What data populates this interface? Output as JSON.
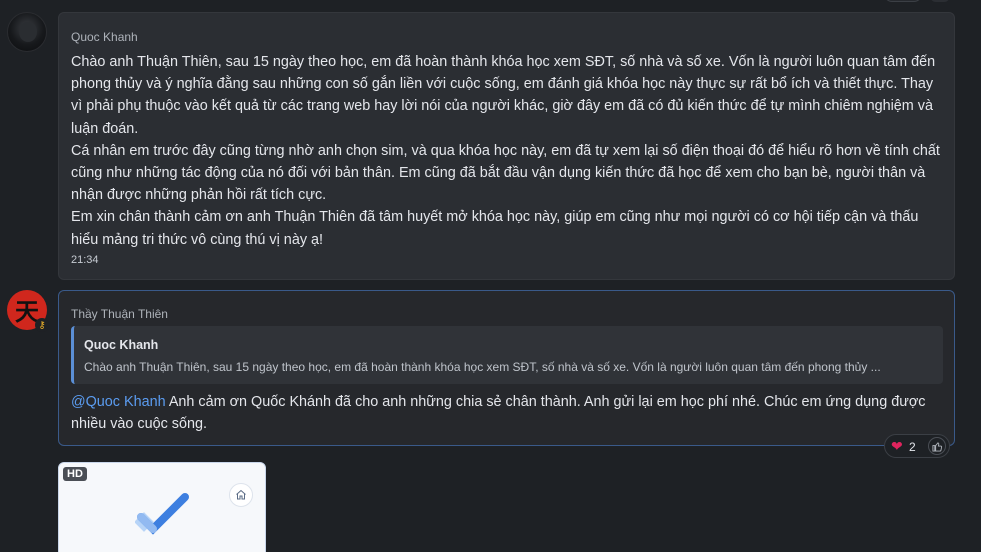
{
  "messages": [
    {
      "author": "Quoc Khanh",
      "paragraphs": [
        "Chào anh Thuận Thiên, sau 15 ngày theo học, em đã hoàn thành khóa học xem SĐT, số nhà và số xe. Vốn là người luôn quan tâm đến phong thủy và ý nghĩa đằng sau những con số gắn liền với cuộc sống, em đánh giá khóa học này thực sự rất bổ ích và thiết thực. Thay vì phải phụ thuộc vào kết quả từ các trang web hay lời nói của người khác, giờ đây em đã có đủ kiến thức để tự mình chiêm nghiệm và luận đoán.",
        "Cá nhân em trước đây cũng từng nhờ anh chọn sim, và qua khóa học này, em đã tự xem lại số điện thoại đó để hiểu rõ hơn về tính chất cũng như những tác động của nó đối với bản thân. Em cũng đã bắt đầu vận dụng kiến thức đã học để xem cho bạn bè, người thân và nhận được những phản hồi rất tích cực.",
        "Em xin chân thành cảm ơn anh Thuận Thiên đã tâm huyết mở khóa học này, giúp em cũng như mọi người có cơ hội tiếp cận và thấu hiểu mảng tri thức vô cùng thú vị này ạ!"
      ],
      "time": "21:34"
    },
    {
      "author": "Thầy Thuận Thiên",
      "quote": {
        "author": "Quoc Khanh",
        "text": "Chào anh Thuận Thiên, sau 15 ngày theo học, em đã hoàn thành khóa học xem SĐT, số nhà và số xe. Vốn là người luôn quan tâm đến phong thủy ..."
      },
      "mention": "@Quoc Khanh",
      "text": " Anh cảm ơn Quốc Khánh đã cho anh những chia sẻ chân thành. Anh gửi lại em học phí nhé. Chúc em ứng dụng được nhiều vào cuộc sống.",
      "reactions": {
        "heart_count": "2"
      }
    }
  ],
  "avatar2_glyph": "天",
  "attachment": {
    "badge": "HD"
  },
  "colors": {
    "background": "#1e2125",
    "message_bg": "#2b2e33",
    "mention": "#5b9cf0",
    "quote_bar": "#5b8fd6",
    "avatar_red": "#d0271d",
    "heart": "#e0245e"
  },
  "icons": [
    "heart-icon",
    "thumbs-up-icon",
    "key-icon",
    "home-icon",
    "checkmark-icon"
  ]
}
